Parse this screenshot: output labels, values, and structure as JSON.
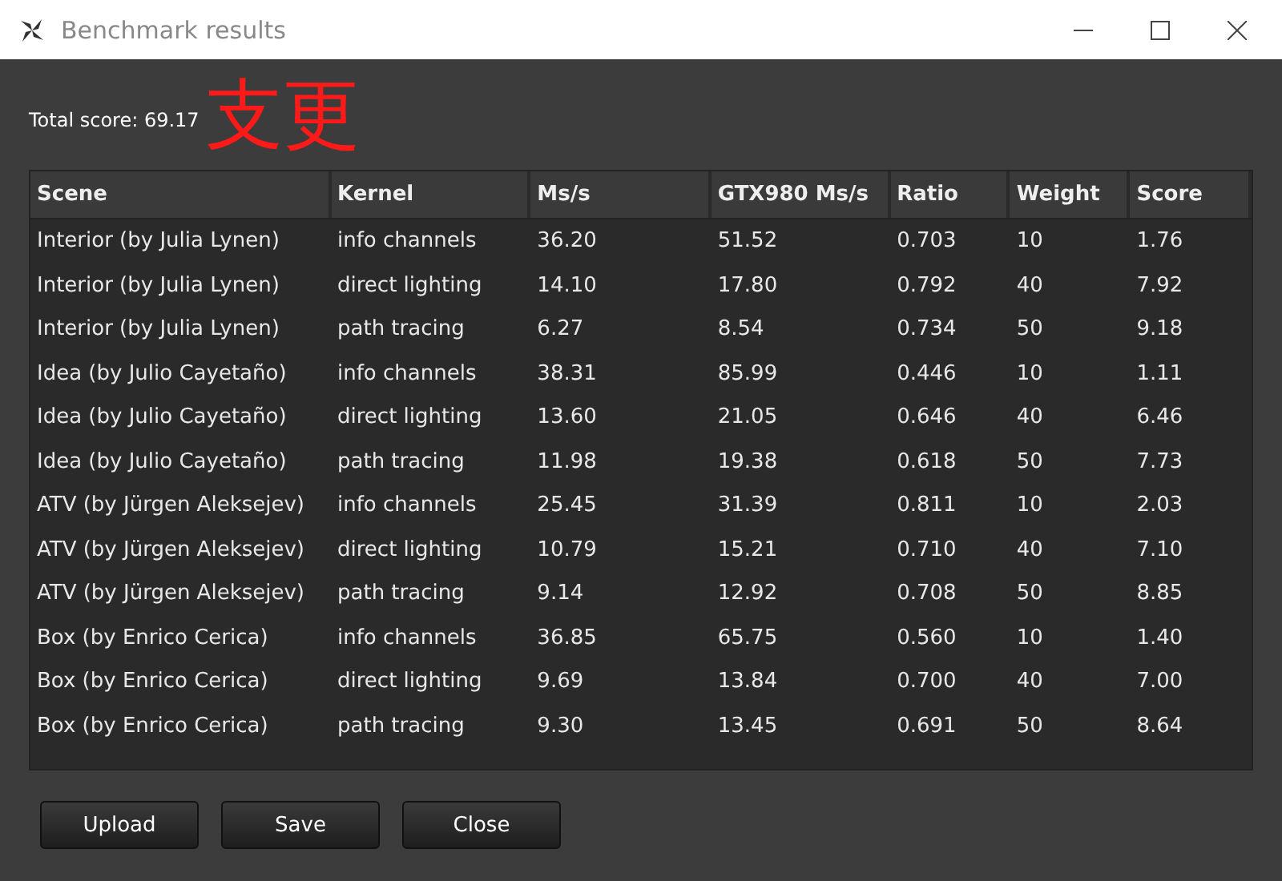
{
  "window": {
    "title": "Benchmark results"
  },
  "total_score": "Total score: 69.17",
  "annotation": "支更",
  "table": {
    "columns": [
      "Scene",
      "Kernel",
      "Ms/s",
      "GTX980 Ms/s",
      "Ratio",
      "Weight",
      "Score"
    ],
    "rows": [
      [
        "Interior (by Julia Lynen)",
        "info channels",
        "36.20",
        "51.52",
        "0.703",
        "10",
        "1.76"
      ],
      [
        "Interior (by Julia Lynen)",
        "direct lighting",
        "14.10",
        "17.80",
        "0.792",
        "40",
        "7.92"
      ],
      [
        "Interior (by Julia Lynen)",
        "path tracing",
        "6.27",
        "8.54",
        "0.734",
        "50",
        "9.18"
      ],
      [
        "Idea (by Julio Cayetaño)",
        "info channels",
        "38.31",
        "85.99",
        "0.446",
        "10",
        "1.11"
      ],
      [
        "Idea (by Julio Cayetaño)",
        "direct lighting",
        "13.60",
        "21.05",
        "0.646",
        "40",
        "6.46"
      ],
      [
        "Idea (by Julio Cayetaño)",
        "path tracing",
        "11.98",
        "19.38",
        "0.618",
        "50",
        "7.73"
      ],
      [
        "ATV (by Jürgen Aleksejev)",
        "info channels",
        "25.45",
        "31.39",
        "0.811",
        "10",
        "2.03"
      ],
      [
        "ATV (by Jürgen Aleksejev)",
        "direct lighting",
        "10.79",
        "15.21",
        "0.710",
        "40",
        "7.10"
      ],
      [
        "ATV (by Jürgen Aleksejev)",
        "path tracing",
        "9.14",
        "12.92",
        "0.708",
        "50",
        "8.85"
      ],
      [
        "Box (by Enrico Cerica)",
        "info channels",
        "36.85",
        "65.75",
        "0.560",
        "10",
        "1.40"
      ],
      [
        "Box (by Enrico Cerica)",
        "direct lighting",
        "9.69",
        "13.84",
        "0.700",
        "40",
        "7.00"
      ],
      [
        "Box (by Enrico Cerica)",
        "path tracing",
        "9.30",
        "13.45",
        "0.691",
        "50",
        "8.64"
      ]
    ]
  },
  "buttons": [
    "Upload",
    "Save",
    "Close"
  ]
}
